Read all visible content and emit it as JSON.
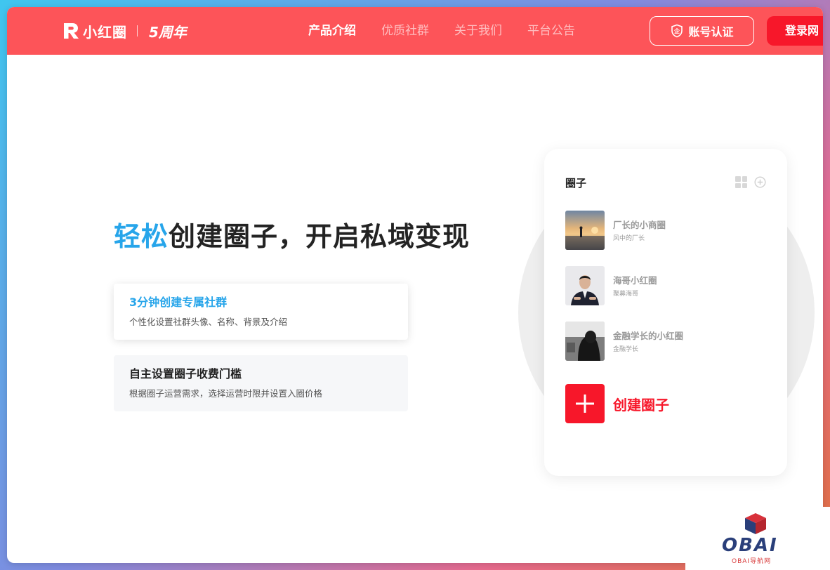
{
  "header": {
    "brand": "小红圈",
    "anniversary": "5周年",
    "nav": [
      {
        "label": "产品介绍",
        "active": true
      },
      {
        "label": "优质社群",
        "active": false
      },
      {
        "label": "关于我们",
        "active": false
      },
      {
        "label": "平台公告",
        "active": false
      }
    ],
    "verify_label": "账号认证",
    "verify_icon_text": "企",
    "login_label": "登录网"
  },
  "hero": {
    "title_highlight": "轻松",
    "title_rest": "创建圈子，开启私域变现"
  },
  "features": [
    {
      "title": "3分钟创建专属社群",
      "desc": "个性化设置社群头像、名称、背景及介绍",
      "active": true
    },
    {
      "title": "自主设置圈子收费门槛",
      "desc": "根据圈子运营需求，选择运营时限并设置入圈价格",
      "active": false
    }
  ],
  "card": {
    "title": "圈子",
    "items": [
      {
        "name": "厂长的小商圈",
        "owner": "风中的厂长",
        "thumb": "sunset-beach-photo"
      },
      {
        "name": "海哥小红圈",
        "owner": "聚募海哥",
        "thumb": "man-in-suit-photo"
      },
      {
        "name": "金融学长的小红圈",
        "owner": "金融学长",
        "thumb": "hooded-figure-photo"
      }
    ],
    "create_label": "创建圈子"
  },
  "watermark": {
    "text": "OBAI",
    "sub": "OBAI导航网"
  },
  "colors": {
    "header_bg": "#fd5459",
    "accent_blue": "#27a5ea",
    "accent_red": "#f7172a"
  }
}
